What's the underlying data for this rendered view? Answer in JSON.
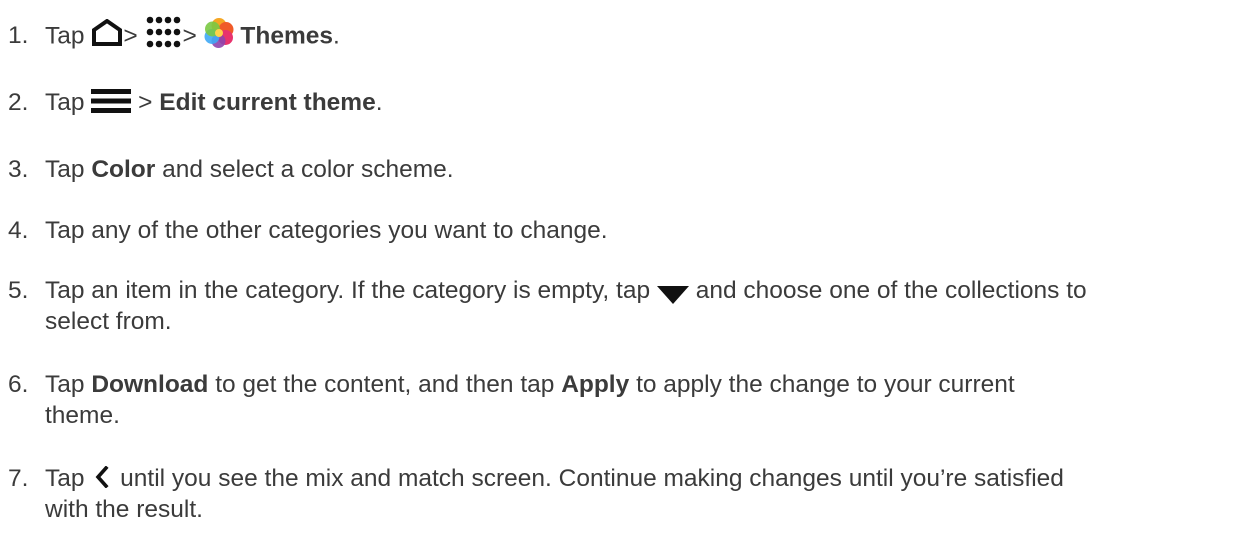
{
  "steps": [
    {
      "number": "1.",
      "t1": "Tap",
      "sep1": ">",
      "sep2": ">",
      "b1": "Themes",
      "t2": ".",
      "icons": [
        "home-icon",
        "apps-grid-icon",
        "themes-app-icon"
      ]
    },
    {
      "number": "2.",
      "t1": "Tap",
      "sep1": ">",
      "b1": "Edit current theme",
      "t2": ".",
      "icons": [
        "menu-icon"
      ]
    },
    {
      "number": "3.",
      "t1": "Tap",
      "b1": "Color",
      "t2": "and select a color scheme."
    },
    {
      "number": "4.",
      "t1": "Tap any of the other categories you want to change."
    },
    {
      "number": "5.",
      "t1": "Tap an item in the category. If the category is empty, tap",
      "t2": "and choose one of the collections to",
      "line2": "select from.",
      "icons": [
        "dropdown-arrow-icon"
      ]
    },
    {
      "number": "6.",
      "t1": "Tap",
      "b1": "Download",
      "t2": "to get the content, and then tap",
      "b2": "Apply",
      "t3": "to apply the change to your current",
      "line2": "theme."
    },
    {
      "number": "7.",
      "t1": "Tap",
      "t2": "until you see the mix and match screen. Continue making changes until you’re satisfied",
      "line2": "with the result.",
      "icons": [
        "back-chevron-icon"
      ]
    }
  ],
  "colors": {
    "text": "#3b3b3b",
    "icon": "#111111",
    "themes_petals": [
      "#f5a623",
      "#f05a28",
      "#e8336d",
      "#8e44ad",
      "#3fa9f5",
      "#7ac943"
    ]
  }
}
